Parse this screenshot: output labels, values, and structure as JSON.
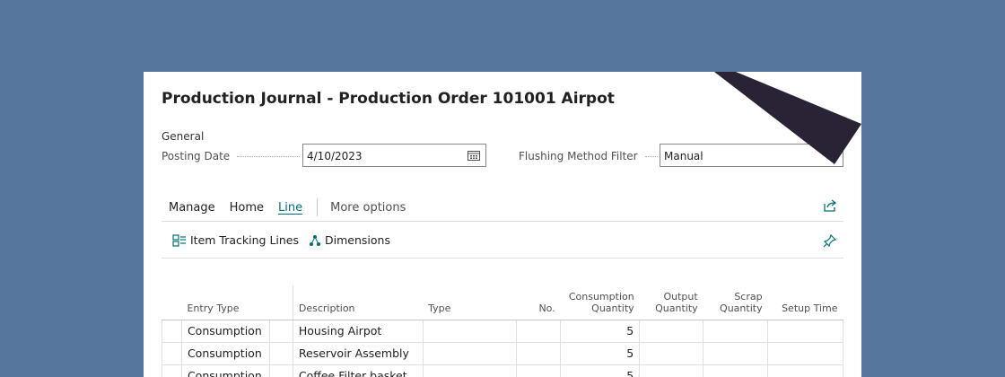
{
  "page": {
    "title": "Production Journal - Production Order 101001 Airpot"
  },
  "general": {
    "section_label": "General",
    "posting_date_label": "Posting Date",
    "posting_date_value": "4/10/2023",
    "flushing_label": "Flushing Method Filter",
    "flushing_value": "Manual"
  },
  "tabs": [
    {
      "label": "Manage"
    },
    {
      "label": "Home"
    },
    {
      "label": "Line",
      "active": true
    },
    {
      "label": "More options"
    }
  ],
  "actions": {
    "item_tracking": "Item Tracking Lines",
    "dimensions": "Dimensions"
  },
  "table": {
    "headers": {
      "entry_type": "Entry Type",
      "description": "Description",
      "type": "Type",
      "no": "No.",
      "consumption_qty_1": "Consumption",
      "consumption_qty_2": "Quantity",
      "output_qty_1": "Output",
      "output_qty_2": "Quantity",
      "scrap_qty_1": "Scrap",
      "scrap_qty_2": "Quantity",
      "setup_time": "Setup Time"
    },
    "rows": [
      {
        "entry_type": "Consumption",
        "description": "Housing Airpot",
        "consumption_qty": "5"
      },
      {
        "entry_type": "Consumption",
        "description": "Reservoir Assembly",
        "consumption_qty": "5"
      },
      {
        "entry_type": "Consumption",
        "description": "Coffee Filter basket",
        "consumption_qty": "5"
      }
    ]
  },
  "colors": {
    "background": "#56769d",
    "accent": "#00707a",
    "overlay_shape": "#2a2336"
  }
}
